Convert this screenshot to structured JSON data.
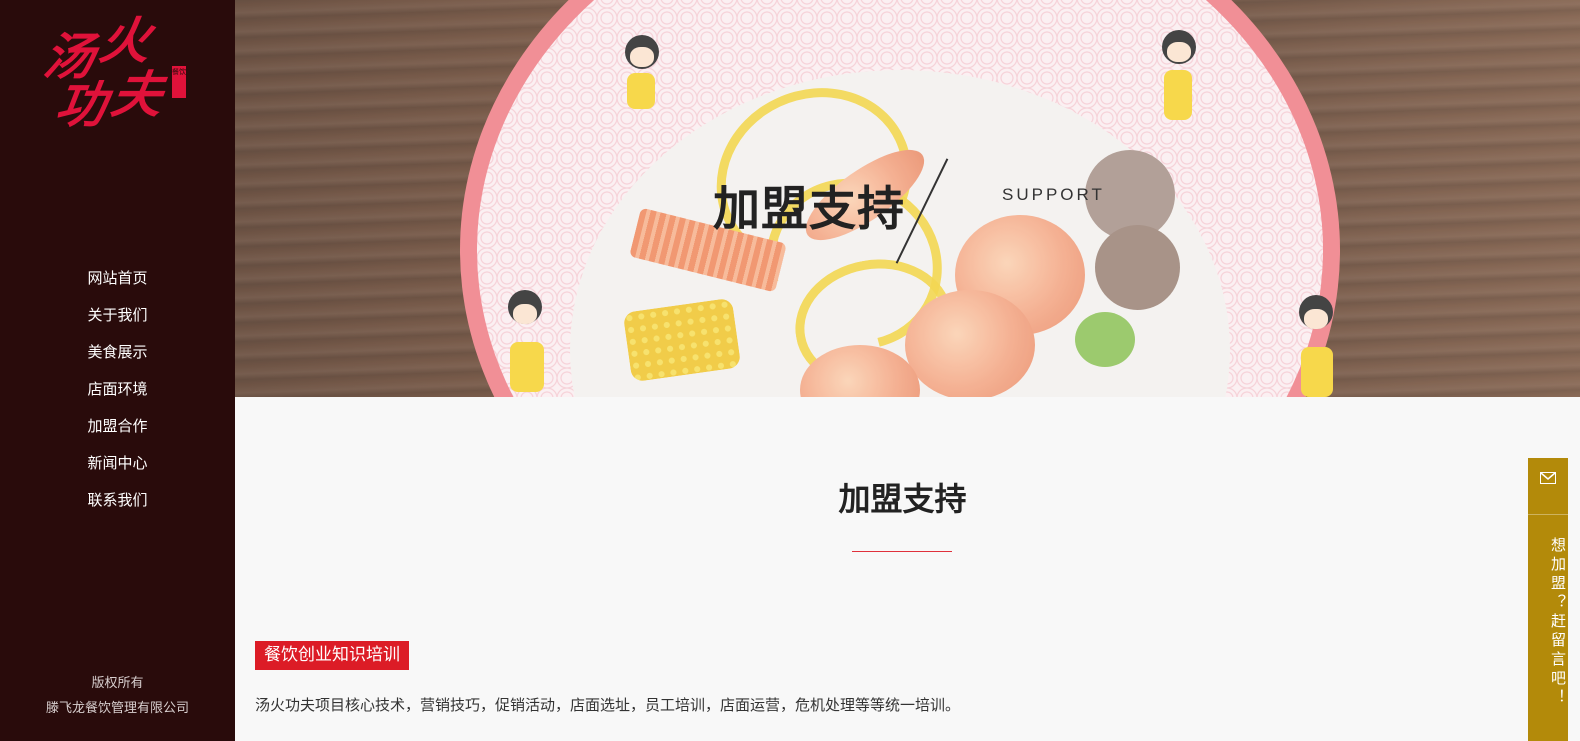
{
  "brand": {
    "logo_chars": [
      "汤",
      "火",
      "功",
      "夫"
    ],
    "stamp_text": "餐饮"
  },
  "nav": {
    "items": [
      {
        "label": "网站首页"
      },
      {
        "label": "关于我们"
      },
      {
        "label": "美食展示"
      },
      {
        "label": "店面环境"
      },
      {
        "label": "加盟合作"
      },
      {
        "label": "新闻中心"
      },
      {
        "label": "联系我们"
      }
    ]
  },
  "footer": {
    "copyright_label": "版权所有",
    "company": "滕飞龙餐饮管理有限公司"
  },
  "banner": {
    "title": "加盟支持",
    "subtitle": "SUPPORT"
  },
  "main": {
    "section_title": "加盟支持",
    "tag": "餐饮创业知识培训",
    "description": "汤火功夫项目核心技术，营销技巧，促销活动，店面选址，员工培训，店面运营，危机处理等等统一培训。"
  },
  "float_widget": {
    "text": "想加盟？赶留言吧！",
    "icon": "mail-icon"
  },
  "colors": {
    "sidebar_bg": "#290b0b",
    "logo_red": "#e0123a",
    "tag_red": "#dc1c26",
    "widget_gold": "#b38a0a"
  }
}
